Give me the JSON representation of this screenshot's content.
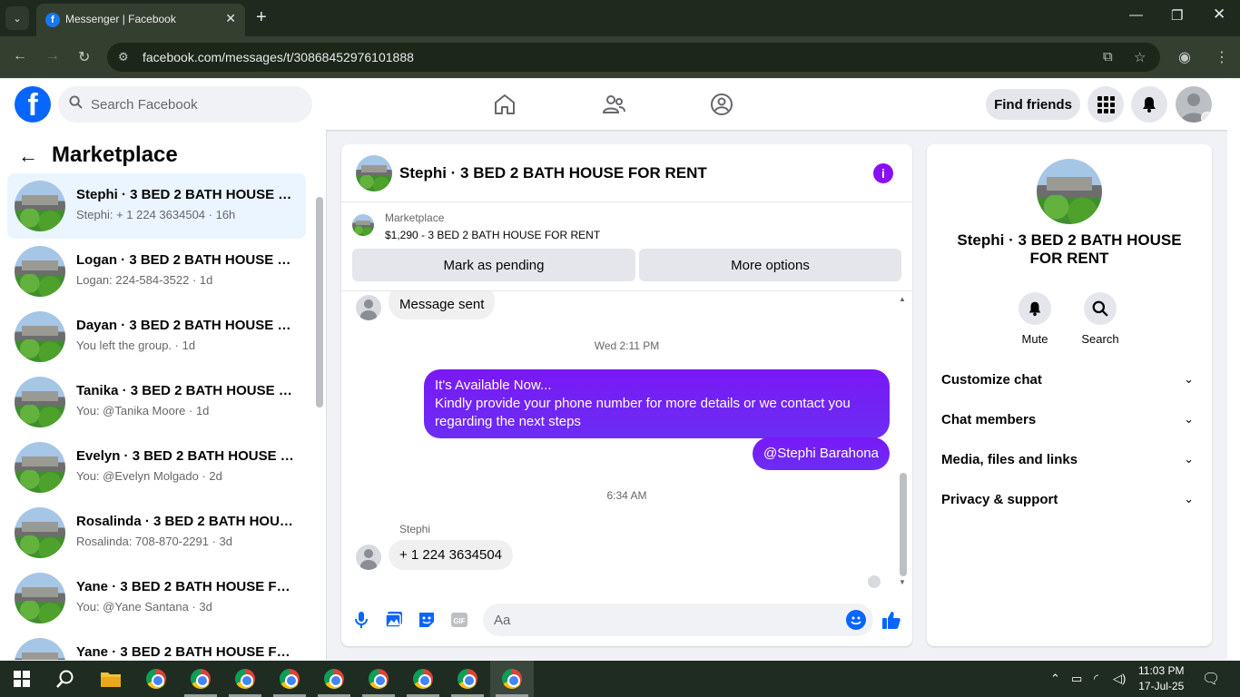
{
  "browser": {
    "tab_title": "Messenger | Facebook",
    "url": "facebook.com/messages/t/30868452976101888"
  },
  "header": {
    "search_placeholder": "Search Facebook",
    "find_friends": "Find friends"
  },
  "left_panel": {
    "title": "Marketplace",
    "conversations": [
      {
        "name": "Stephi · 3 BED 2 BATH HOUSE F...",
        "sub": "Stephi: + 1 224 3634504 · 16h"
      },
      {
        "name": "Logan · 3 BED 2 BATH HOUSE F...",
        "sub": "Logan: 224-584-3522 · 1d"
      },
      {
        "name": "Dayan · 3 BED 2 BATH HOUSE F...",
        "sub": "You left the group. · 1d"
      },
      {
        "name": "Tanika · 3 BED 2 BATH HOUSE F...",
        "sub": "You: @Tanika Moore · 1d"
      },
      {
        "name": "Evelyn · 3 BED 2 BATH HOUSE F...",
        "sub": "You: @Evelyn Molgado · 2d"
      },
      {
        "name": "Rosalinda · 3 BED 2 BATH HOUS...",
        "sub": "Rosalinda: 708-870-2291 · 3d"
      },
      {
        "name": "Yane · 3 BED 2 BATH HOUSE FO...",
        "sub": "You: @Yane Santana · 3d"
      },
      {
        "name": "Yane · 3 BED 2 BATH HOUSE FO...",
        "sub": ""
      }
    ]
  },
  "chat": {
    "title": "Stephi · 3 BED 2 BATH HOUSE FOR RENT",
    "marketplace_label": "Marketplace",
    "listing": "$1,290 - 3 BED 2 BATH HOUSE FOR RENT",
    "mark_pending": "Mark as pending",
    "more_options": "More options",
    "messages": {
      "m1": "Message sent",
      "ts1": "Wed 2:11 PM",
      "out1_line1": "It's Available Now...",
      "out1_line2": "Kindly provide your phone number for more details or we contact you",
      "out1_line3": "regarding the next steps",
      "out2": "@Stephi Barahona",
      "ts2": "6:34 AM",
      "sender": "Stephi",
      "in2": "+ 1 224 3634504"
    },
    "composer_placeholder": "Aa"
  },
  "right_panel": {
    "name": "Stephi · 3 BED 2 BATH HOUSE FOR RENT",
    "mute": "Mute",
    "search": "Search",
    "rows": [
      "Customize chat",
      "Chat members",
      "Media, files and links",
      "Privacy & support"
    ]
  },
  "taskbar": {
    "time": "11:03 PM",
    "date": "17-Jul-25"
  },
  "colors": {
    "fb_blue": "#0866ff",
    "messenger_purple": "#7a18f6",
    "active_conv_bg": "#ebf5ff"
  }
}
